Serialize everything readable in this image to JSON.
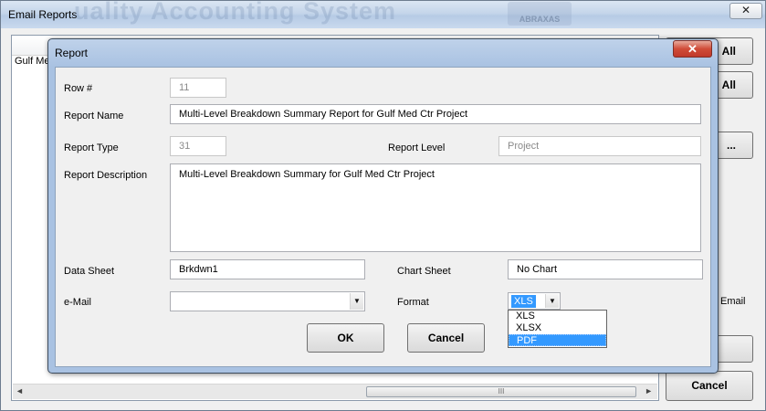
{
  "background_window": {
    "title": "Email Reports",
    "watermark": "uality Accounting System",
    "watermark_logo": "ABRAXAS",
    "close_glyph": "✕",
    "list_cell": "Gulf Med",
    "buttons": [
      "All",
      "All",
      "..."
    ],
    "email_label": "Email",
    "cancel_label": "Cancel",
    "scroll_left": "◄",
    "scroll_right": "►",
    "scroll_grip": "III"
  },
  "dialog": {
    "title": "Report",
    "close_glyph": "✕",
    "fields": {
      "row_number": {
        "label": "Row #",
        "value": "11"
      },
      "report_name": {
        "label": "Report Name",
        "value": "Multi-Level Breakdown Summary Report for Gulf Med Ctr Project"
      },
      "report_type": {
        "label": "Report Type",
        "value": "31"
      },
      "report_level": {
        "label": "Report Level",
        "value": "Project"
      },
      "report_description": {
        "label": "Report Description",
        "value": "Multi-Level Breakdown Summary for  Gulf Med Ctr Project"
      },
      "data_sheet": {
        "label": "Data Sheet",
        "value": "Brkdwn1"
      },
      "chart_sheet": {
        "label": "Chart Sheet",
        "value": "No Chart"
      },
      "email": {
        "label": "e-Mail",
        "value": ""
      },
      "format": {
        "label": "Format",
        "value": "XLS",
        "options": [
          "XLS",
          "XLSX",
          "PDF"
        ],
        "highlighted": "PDF"
      }
    },
    "buttons": {
      "ok": "OK",
      "cancel": "Cancel"
    },
    "dropdown_glyph": "▼"
  }
}
